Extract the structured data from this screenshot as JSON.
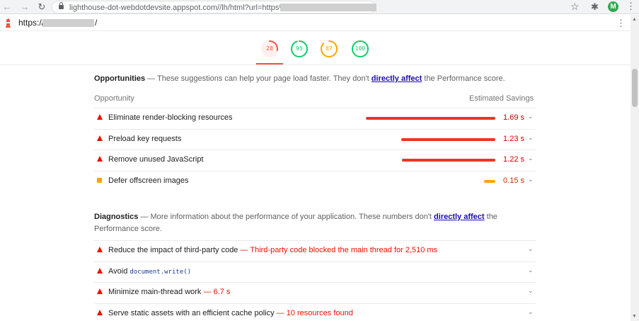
{
  "browser": {
    "back_icon": "←",
    "forward_icon": "→",
    "reload_icon": "↻",
    "url": "lighthouse-dot-webdotdevsite.appspot.com//lh/html?url=https%3A//",
    "star_icon": "☆",
    "extensions_icon": "✱",
    "avatar_letter": "M",
    "menu_icon": "⋮"
  },
  "lighthouse_bar": {
    "url_prefix": "https://",
    "url_suffix": "/",
    "menu_icon": "⋮"
  },
  "gauges": [
    {
      "score": "28",
      "value": 28,
      "color": "#ff4e42",
      "bg": "#fff0ef"
    },
    {
      "score": "95",
      "value": 95,
      "color": "#0cce6b",
      "bg": "#ffffff"
    },
    {
      "score": "87",
      "value": 87,
      "color": "#ffa400",
      "bg": "#ffffff"
    },
    {
      "score": "100",
      "value": 100,
      "color": "#0cce6b",
      "bg": "#ffffff"
    }
  ],
  "opportunities": {
    "title": "Opportunities",
    "description_prefix": " — These suggestions can help your page load faster. They don't ",
    "link": "directly affect",
    "description_suffix": " the Performance score.",
    "col_opportunity": "Opportunity",
    "col_savings": "Estimated Savings",
    "items": [
      {
        "title": "Eliminate render-blocking resources",
        "savings": "1.69 s",
        "value": 1.69,
        "status": "fail"
      },
      {
        "title": "Preload key requests",
        "savings": "1.23 s",
        "value": 1.23,
        "status": "fail"
      },
      {
        "title": "Remove unused JavaScript",
        "savings": "1.22 s",
        "value": 1.22,
        "status": "fail"
      },
      {
        "title": "Defer offscreen images",
        "savings": "0.15 s",
        "value": 0.15,
        "status": "average"
      }
    ]
  },
  "diagnostics": {
    "title": "Diagnostics",
    "description_prefix": " — More information about the performance of your application. These numbers don't ",
    "link": "directly affect",
    "description_suffix": " the Performance score.",
    "items": [
      {
        "title": "Reduce the impact of third-party code",
        "note": " — Third-party code blocked the main thread for 2,510 ms"
      },
      {
        "title": "Avoid ",
        "code": "document.write()",
        "note": ""
      },
      {
        "title": "Minimize main-thread work",
        "note": " — 6.7 s"
      },
      {
        "title": "Serve static assets with an efficient cache policy",
        "note": " — 10 resources found"
      }
    ]
  },
  "chevron_icon": "⌄"
}
